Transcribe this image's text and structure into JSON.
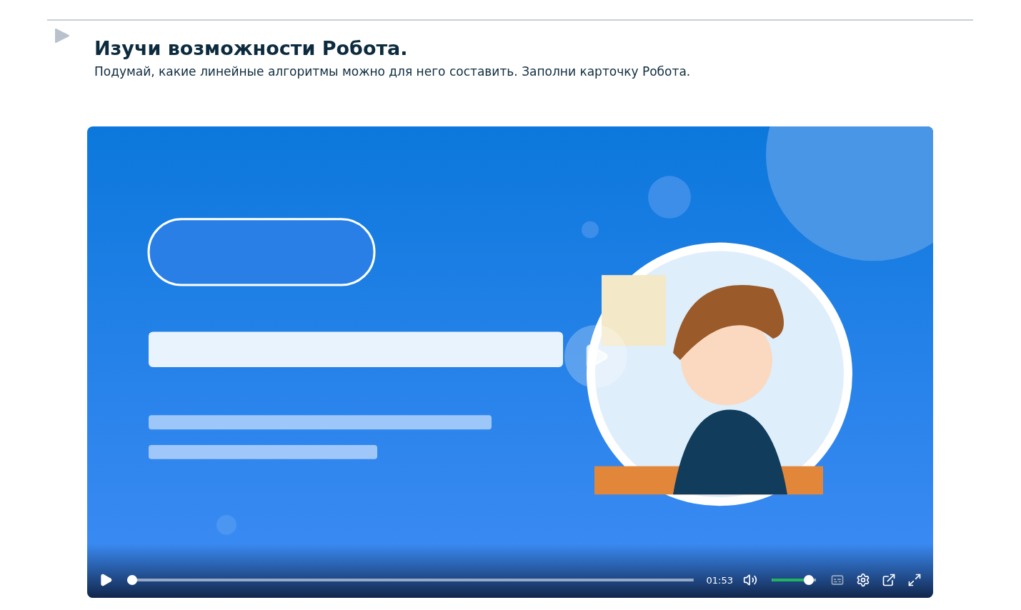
{
  "section": {
    "title": "Изучи возможности Робота.",
    "description": "Подумай, какие линейные алгоритмы можно для него составить. Заполни карточку Робота."
  },
  "video": {
    "kind": "picture",
    "progress": {
      "level": 0
    },
    "time": "01:53",
    "volume": {
      "level": 0.94
    }
  }
}
